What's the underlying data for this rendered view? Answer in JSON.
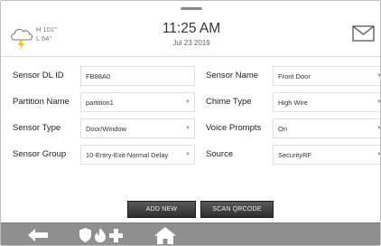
{
  "header": {
    "weather": {
      "icon": "storm-cloud-icon",
      "high": "H 101°",
      "low": "L 64°"
    },
    "time": "11:25 AM",
    "date": "Jul 23 2019",
    "mail_icon": "mail-icon"
  },
  "form": {
    "rows": [
      {
        "left_label": "Sensor DL ID",
        "left_value": "FB88A0",
        "right_label": "Sensor Name",
        "right_value": "Front Door"
      },
      {
        "left_label": "Partition Name",
        "left_value": "partition1",
        "right_label": "Chime Type",
        "right_value": "High Wire"
      },
      {
        "left_label": "Sensor Type",
        "left_value": "Door/Window",
        "right_label": "Voice Prompts",
        "right_value": "On"
      },
      {
        "left_label": "Sensor Group",
        "left_value": "10-Entry-Exit-Normal Delay",
        "right_label": "Source",
        "right_value": "SecurityRF"
      }
    ]
  },
  "buttons": {
    "add_new": "ADD NEW",
    "scan_qrcode": "SCAN QRCODE"
  },
  "footer": {
    "icons": [
      "back-arrow-icon",
      "shield-icon",
      "fire-icon",
      "medical-cross-icon",
      "home-icon"
    ]
  },
  "colors": {
    "button_dark": "#3a3a3a",
    "footer_bar": "#8f8f8f",
    "storm_yellow": "#f2c200"
  }
}
